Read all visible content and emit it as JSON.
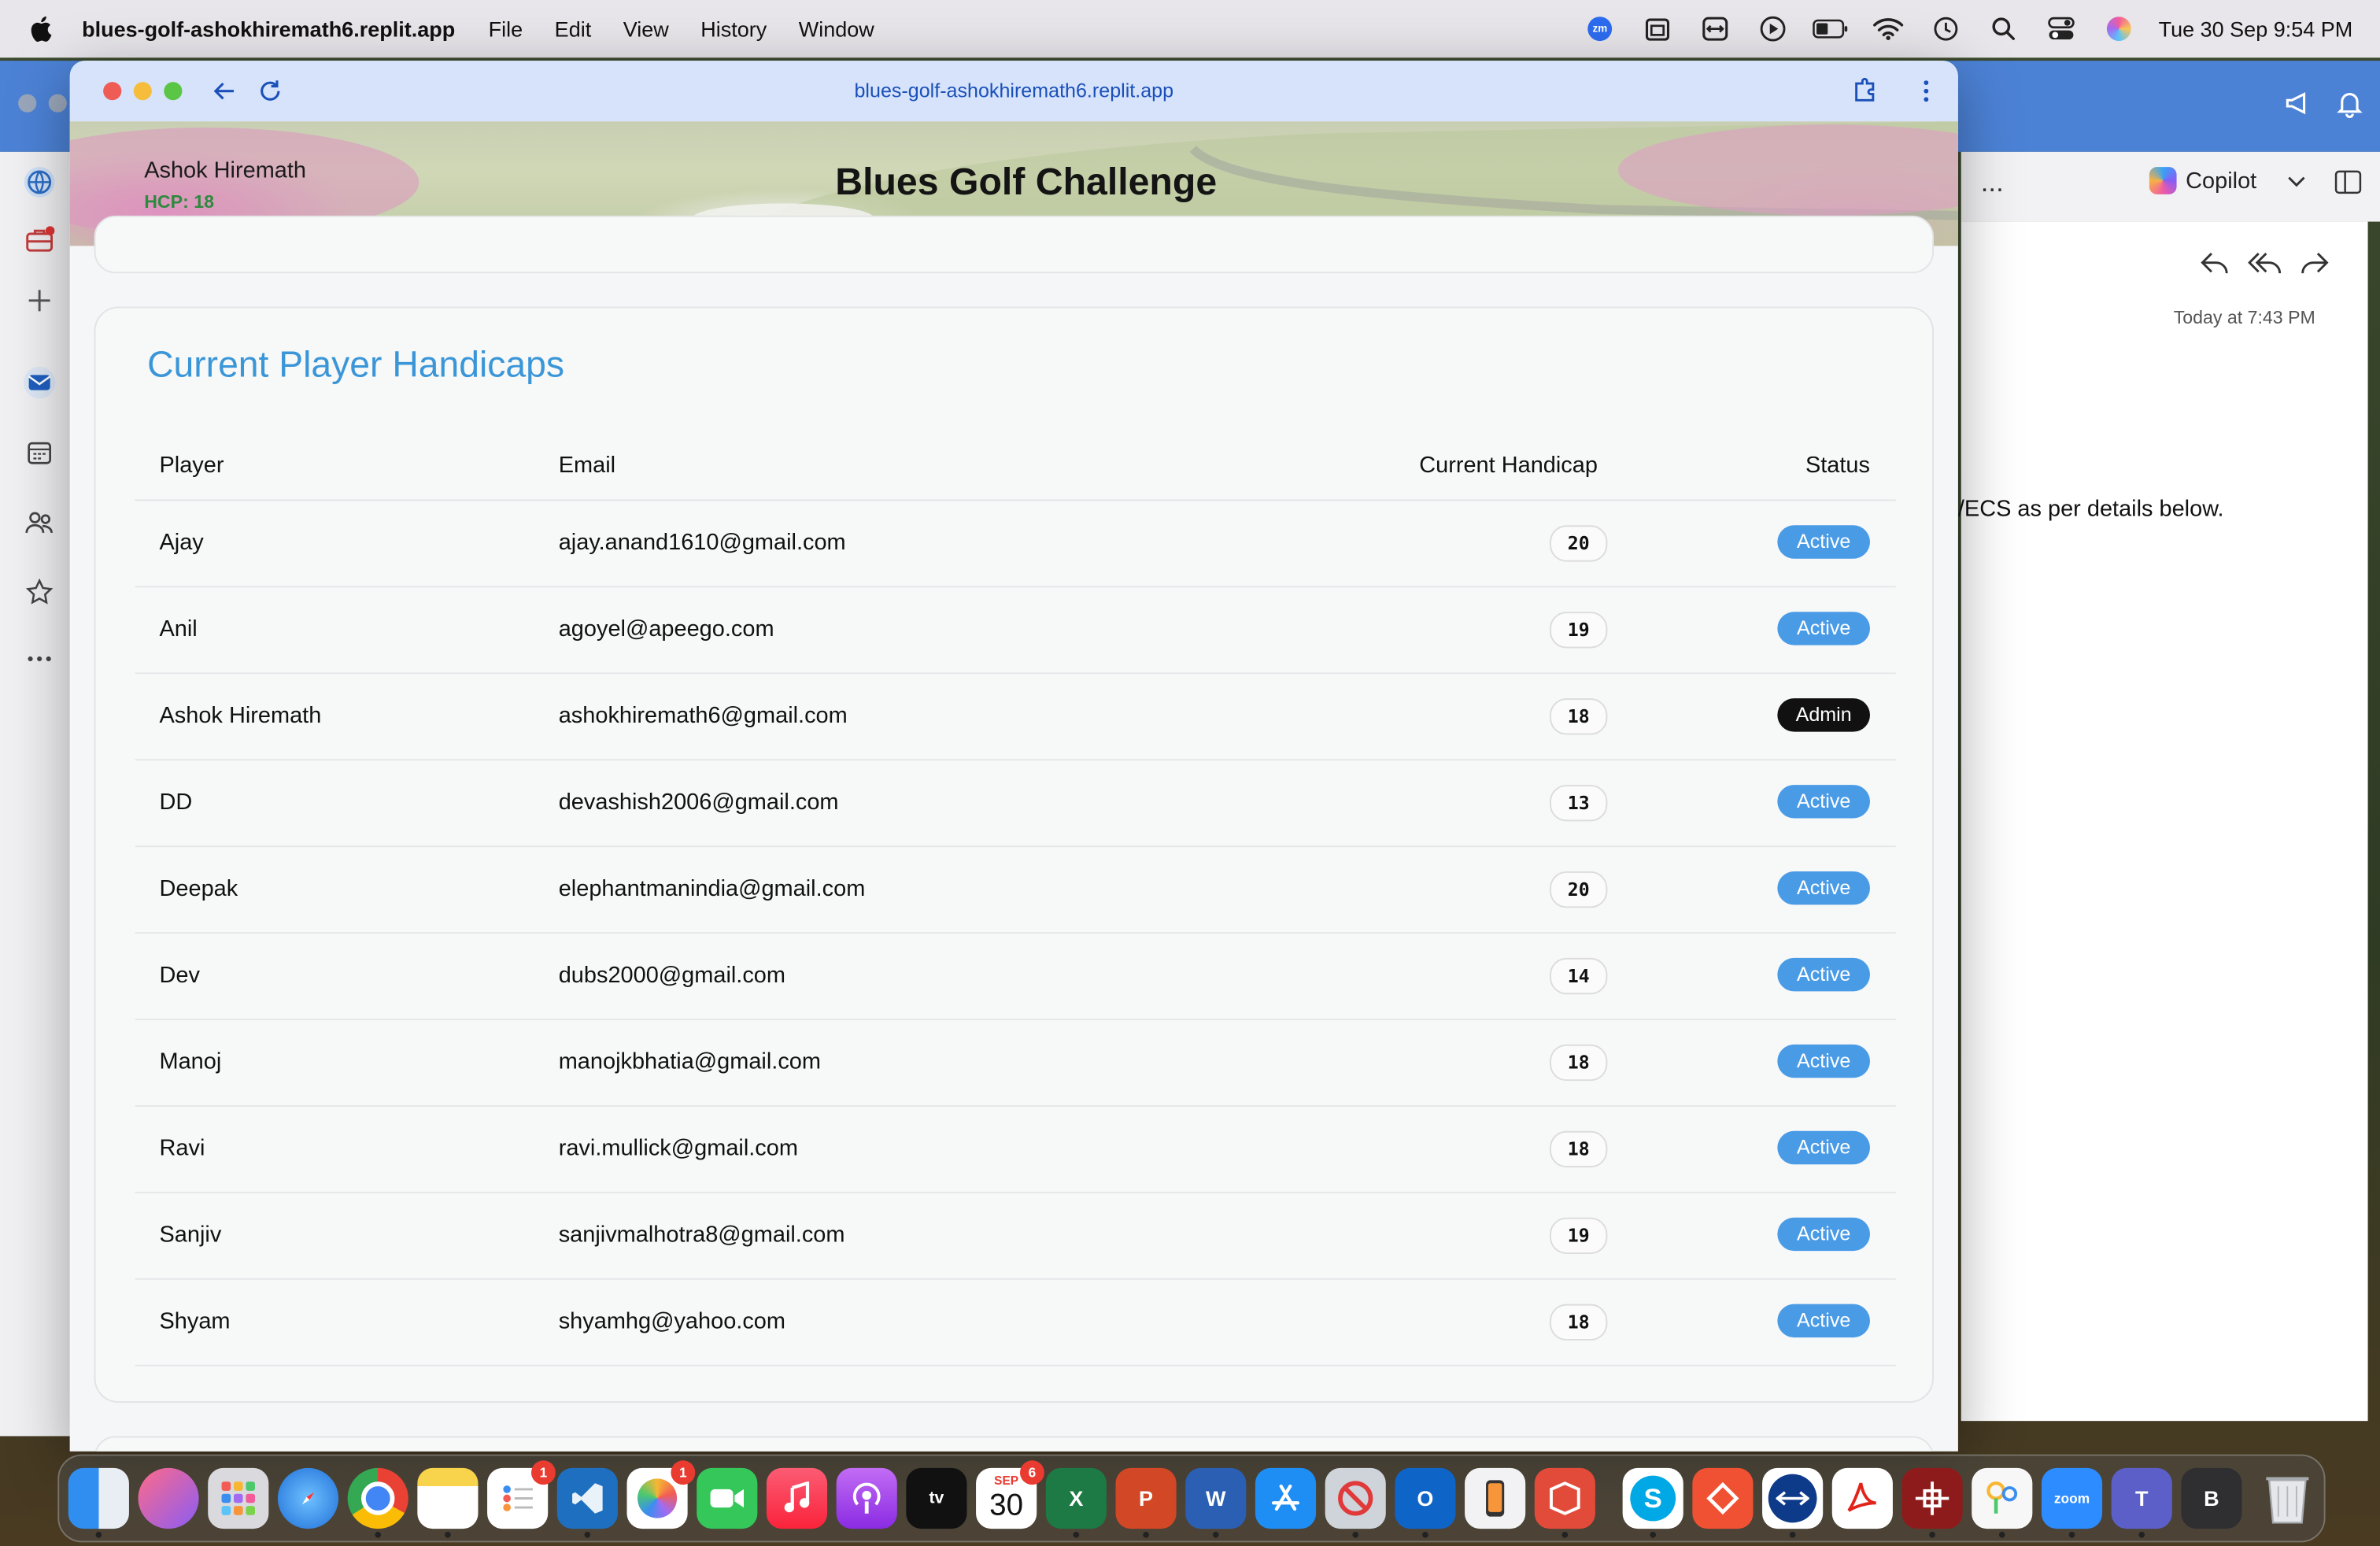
{
  "menubar": {
    "app_name": "blues-golf-ashokhiremath6.replit.app",
    "menus": [
      "File",
      "Edit",
      "View",
      "History",
      "Window"
    ],
    "zoom_label": "zm",
    "datetime": "Tue 30 Sep  9:54 PM"
  },
  "browser": {
    "url": "blues-golf-ashokhiremath6.replit.app"
  },
  "banner": {
    "user_name": "Ashok Hiremath",
    "hcp": "HCP: 18",
    "title": "Blues Golf Challenge"
  },
  "handicaps": {
    "title": "Current Player Handicaps",
    "columns": [
      "Player",
      "Email",
      "Current Handicap",
      "Status"
    ],
    "rows": [
      {
        "player": "Ajay",
        "email": "ajay.anand1610@gmail.com",
        "handicap": "20",
        "status": "Active"
      },
      {
        "player": "Anil",
        "email": "agoyel@apeego.com",
        "handicap": "19",
        "status": "Active"
      },
      {
        "player": "Ashok Hiremath",
        "email": "ashokhiremath6@gmail.com",
        "handicap": "18",
        "status": "Admin"
      },
      {
        "player": "DD",
        "email": "devashish2006@gmail.com",
        "handicap": "13",
        "status": "Active"
      },
      {
        "player": "Deepak",
        "email": "elephantmanindia@gmail.com",
        "handicap": "20",
        "status": "Active"
      },
      {
        "player": "Dev",
        "email": "dubs2000@gmail.com",
        "handicap": "14",
        "status": "Active"
      },
      {
        "player": "Manoj",
        "email": "manojkbhatia@gmail.com",
        "handicap": "18",
        "status": "Active"
      },
      {
        "player": "Ravi",
        "email": "ravi.mullick@gmail.com",
        "handicap": "18",
        "status": "Active"
      },
      {
        "player": "Sanjiv",
        "email": "sanjivmalhotra8@gmail.com",
        "handicap": "19",
        "status": "Active"
      },
      {
        "player": "Shyam",
        "email": "shyamhg@yahoo.com",
        "handicap": "18",
        "status": "Active"
      }
    ]
  },
  "outlook": {
    "more": "...",
    "copilot": "Copilot",
    "time": "Today at 7:43 PM",
    "body_fragment": "/ECS as per details below."
  },
  "dock": {
    "calendar_month": "SEP",
    "calendar_day": "30",
    "calendar_badge": "6",
    "reminders_badge": "1",
    "photos_badge": "1",
    "appletv_label": "tv",
    "zoom_label": "zoom",
    "bbedit_label": "B"
  },
  "colors": {
    "accent_blue": "#3b96d8",
    "status_active": "#4a9be6",
    "status_admin": "#111111",
    "hcp_green": "#2d8a3e"
  }
}
